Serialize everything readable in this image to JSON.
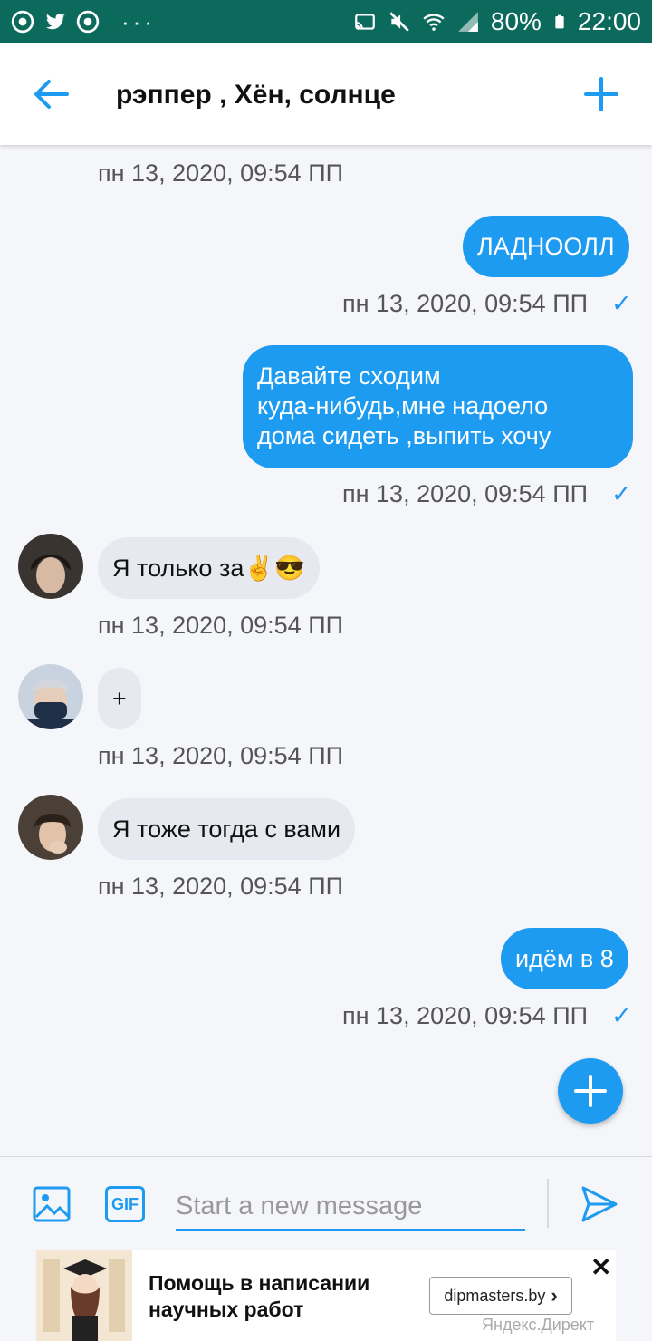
{
  "status_bar": {
    "battery": "80%",
    "time": "22:00",
    "dots": "···",
    "icons": [
      "chrome-icon",
      "twitter-icon",
      "chrome-icon",
      "cast-icon",
      "mute-icon",
      "wifi-icon",
      "signal-icon",
      "battery-icon"
    ]
  },
  "header": {
    "title": "рэппер , Хён, солнце",
    "back_icon": "arrow-left-icon",
    "add_icon": "plus-icon"
  },
  "messages": [
    {
      "type": "timestamp",
      "text": "пн 13, 2020, 09:54 ПП"
    },
    {
      "type": "out",
      "text": "ЛАДНООЛЛ",
      "time": "пн 13, 2020, 09:54 ПП",
      "read": "✓"
    },
    {
      "type": "out",
      "lines": [
        "Давайте сходим",
        "куда-нибудь,мне надоело",
        "дома сидеть ,выпить хочу"
      ],
      "time": "пн 13, 2020, 09:54 ПП",
      "read": "✓"
    },
    {
      "type": "in",
      "text": "Я только за✌😎",
      "time": "пн 13, 2020, 09:54 ПП"
    },
    {
      "type": "in",
      "text": "+",
      "time": "пн 13, 2020, 09:54 ПП"
    },
    {
      "type": "in",
      "text": "Я тоже тогда с вами",
      "time": "пн 13, 2020, 09:54 ПП"
    },
    {
      "type": "out",
      "text": "идём в 8",
      "time": "пн 13, 2020, 09:54 ПП",
      "read": "✓"
    }
  ],
  "composer": {
    "placeholder": "Start a new message",
    "gif_label": "GIF"
  },
  "ad": {
    "title": "Помощь в написании научных работ",
    "button": "dipmasters.by",
    "button_chevron": "›",
    "close": "✕",
    "source": "Яндекс.Директ"
  },
  "colors": {
    "status_bar": "#0c6a5c",
    "accent": "#1d9bf0",
    "incoming_bubble": "#e7e9f0",
    "background": "#f5f6fa"
  }
}
